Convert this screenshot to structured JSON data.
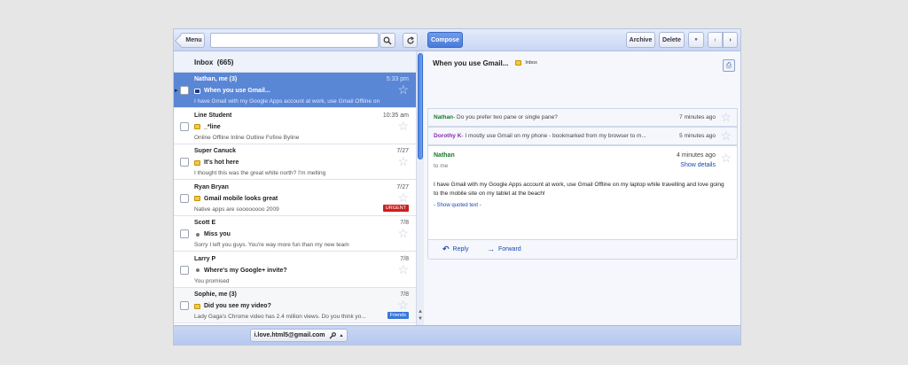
{
  "toolbar": {
    "menu_label": "Menu",
    "search_placeholder": "",
    "search_icon": "search-icon",
    "refresh_icon": "refresh-icon",
    "compose_label": "Compose",
    "archive_label": "Archive",
    "delete_label": "Delete",
    "more_label": "»",
    "prev_label": "‹",
    "next_label": "›"
  },
  "inbox": {
    "title": "Inbox",
    "count": "(665)"
  },
  "messages": [
    {
      "from": "Nathan, me (3)",
      "time": "5:33 pm",
      "subject": "When you use Gmail...",
      "snippet": "I have Gmail with my Google Apps account at work, use Gmail Offline on",
      "marker": "important",
      "selected": true
    },
    {
      "from": "Line Student",
      "time": "10:35 am",
      "subject": "_*line",
      "snippet": "Online Offline Inline Outline Fofine Byline",
      "marker": "important"
    },
    {
      "from": "Super Canuck",
      "time": "7/27",
      "subject": "It's hot here",
      "snippet": "I thought this was the great white north? I'm melting",
      "marker": "important"
    },
    {
      "from": "Ryan Bryan",
      "time": "7/27",
      "subject": "Gmail mobile looks great",
      "snippet": "Native apps are soooooooo 2009",
      "marker": "important",
      "label": "URGENT",
      "label_color": "#cc1f1f"
    },
    {
      "from": "Scott E",
      "time": "7/8",
      "subject": "Miss you",
      "snippet": "Sorry I left you guys. You're way more fun than my new team",
      "marker": "bullet"
    },
    {
      "from": "Larry P",
      "time": "7/8",
      "subject": "Where's my Google+ invite?",
      "snippet": "You promised",
      "marker": "bullet"
    },
    {
      "from": "Sophie, me (3)",
      "time": "7/8",
      "subject": "Did you see my video?",
      "snippet": "Lady Gaga's Chrome video has 2.4 million views. Do you think yo...",
      "marker": "important",
      "label": "Friends",
      "label_color": "#3a78d8"
    }
  ],
  "account": {
    "email": "i.love.html5@gmail.com",
    "wrench_icon": "wrench-icon",
    "caret": "▲"
  },
  "thread": {
    "title": "When you use Gmail...",
    "label": "Inbox",
    "print_icon": "print-icon",
    "collapsed": [
      {
        "sender": "Nathan",
        "sender_color": "#167a2a",
        "text": " - Do you prefer two pane or single pane?",
        "when": "7 minutes ago"
      },
      {
        "sender": "Dorothy K",
        "sender_color": "#8a2ba8",
        "text": " - I mostly use Gmail on my phone - bookmarked from my browser to m...",
        "when": "5 minutes ago"
      }
    ],
    "open": {
      "sender": "Nathan",
      "to": "to me",
      "when": "4 minutes ago",
      "details_label": "Show details",
      "body": "I have Gmail with my Google Apps account at work, use Gmail Offline on my laptop while travelling and love going to the mobile site on my tablet at the beach!",
      "quoted_label": "- Show quoted text -"
    },
    "actions": {
      "reply": "Reply",
      "forward": "Forward"
    }
  }
}
